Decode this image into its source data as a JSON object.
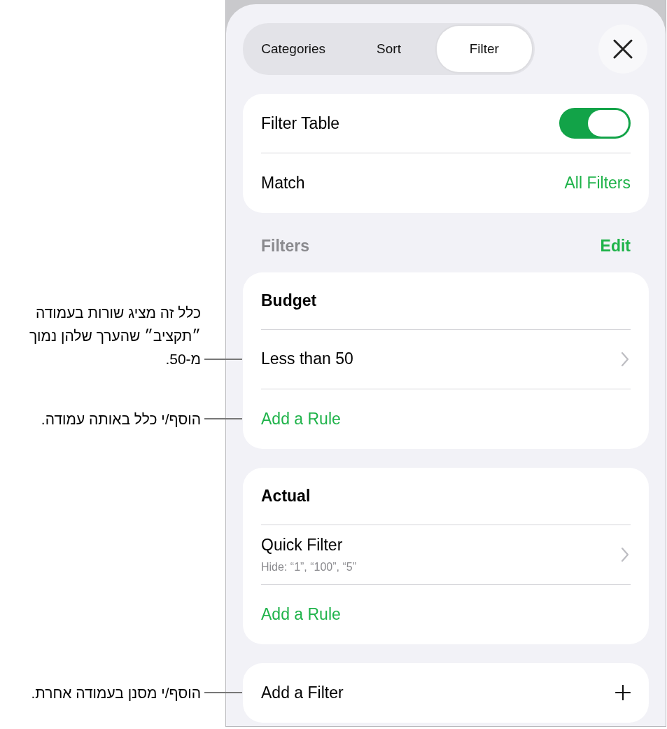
{
  "tabs": [
    {
      "label": "Categories",
      "selected": false
    },
    {
      "label": "Sort",
      "selected": false
    },
    {
      "label": "Filter",
      "selected": true
    }
  ],
  "settings": [
    {
      "kind": "toggle",
      "label": "Filter Table",
      "on": true
    },
    {
      "kind": "value",
      "label": "Match",
      "value": "All Filters"
    }
  ],
  "filters_header": {
    "title": "Filters",
    "action": "Edit"
  },
  "filters": [
    {
      "column": "Budget",
      "rules": [
        {
          "title": "Less than 50"
        }
      ],
      "add_rule": "Add a Rule"
    },
    {
      "column": "Actual",
      "rules": [
        {
          "title": "Quick Filter",
          "detail": "Hide: “1”, “100”, “5”"
        }
      ],
      "add_rule": "Add a Rule"
    }
  ],
  "add_filter": {
    "label": "Add a Filter"
  },
  "callouts": [
    {
      "text": "כלל זה מציג שורות בעמודה ״תקציב״ שהערך שלהן נמוך מ-50."
    },
    {
      "text": "הוסף/י כלל באותה עמודה."
    },
    {
      "text": "הוסף/י מסנן בעמודה אחרת."
    }
  ]
}
